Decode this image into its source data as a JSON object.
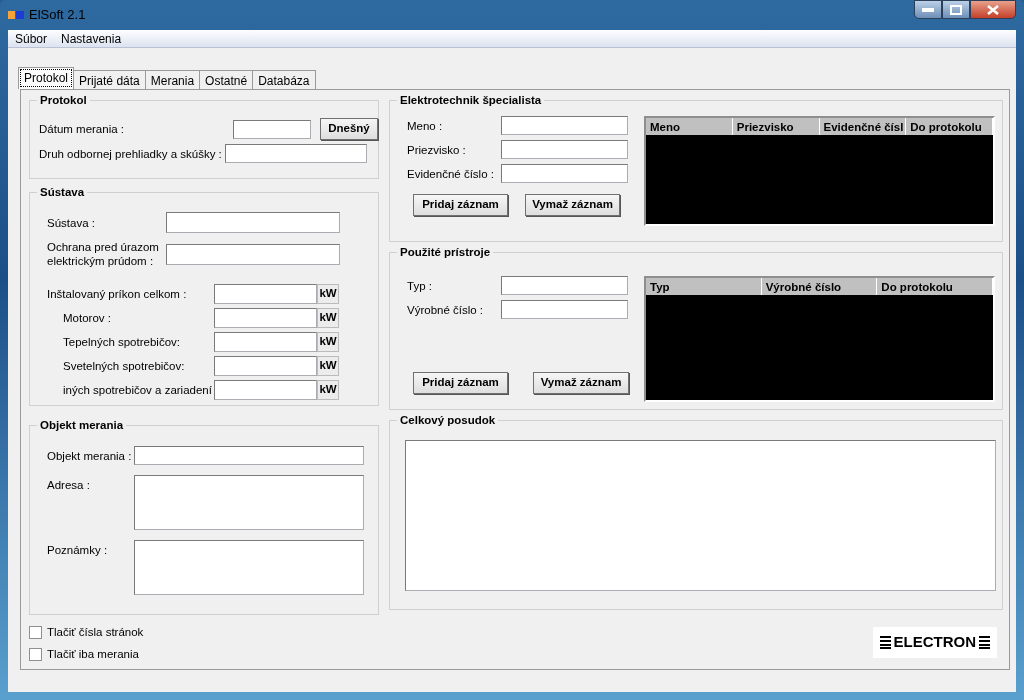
{
  "window": {
    "title": "ElSoft 2.1"
  },
  "menu": [
    {
      "label": "Súbor"
    },
    {
      "label": "Nastavenia"
    }
  ],
  "tabs": [
    {
      "label": "Protokol",
      "selected": true
    },
    {
      "label": "Prijaté dáta",
      "selected": false
    },
    {
      "label": "Merania",
      "selected": false
    },
    {
      "label": "Ostatné",
      "selected": false
    },
    {
      "label": "Databáza",
      "selected": false
    }
  ],
  "protokol": {
    "title": "Protokol",
    "rows": [
      {
        "label": "Dátum merania :",
        "button": "Dnešný"
      },
      {
        "label": "Druh odbornej prehliadky a skúšky :"
      }
    ]
  },
  "sustava": {
    "title": "Sústava",
    "rows": [
      {
        "kind": "text",
        "label": "Sústava :"
      },
      {
        "kind": "text",
        "label": "Ochrana pred úrazom elektrickým prúdom :"
      },
      {
        "kind": "total",
        "label": "Inštalovaný príkon celkom :",
        "unit": "kW"
      },
      {
        "kind": "part",
        "label": "Motorov :",
        "unit": "kW"
      },
      {
        "kind": "part",
        "label": "Tepelných spotrebičov:",
        "unit": "kW"
      },
      {
        "kind": "part",
        "label": "Svetelných spotrebičov:",
        "unit": "kW"
      },
      {
        "kind": "part",
        "label": "iných spotrebičov a zariadení",
        "unit": "kW"
      }
    ]
  },
  "objekt": {
    "title": "Objekt merania",
    "rows": [
      {
        "kind": "line",
        "label": "Objekt merania :"
      },
      {
        "kind": "area",
        "label": "Adresa :"
      },
      {
        "kind": "area",
        "label": "Poznámky :"
      }
    ]
  },
  "checkboxes": [
    {
      "label": "Tlačiť čísla stránok",
      "checked": false
    },
    {
      "label": "Tlačiť iba merania",
      "checked": false
    }
  ],
  "panels": [
    {
      "title": "Elektrotechnik špecialista",
      "fields": [
        "Meno :",
        "Priezvisko :",
        "Evidenčné číslo :"
      ],
      "buttons": [
        "Pridaj záznam",
        "Vymaž záznam"
      ],
      "table": {
        "columns": [
          "Meno",
          "Priezvisko",
          "Evidenčné čísl",
          "Do protokolu"
        ]
      }
    },
    {
      "title": "Použité prístroje",
      "fields": [
        "Typ :",
        "Výrobné číslo :"
      ],
      "buttons": [
        "Pridaj záznam",
        "Vymaž záznam"
      ],
      "table": {
        "columns": [
          "Typ",
          "Výrobné číslo",
          "Do protokolu"
        ]
      }
    }
  ],
  "posudok": {
    "title": "Celkový posudok"
  },
  "logo": {
    "text": "ELECTRON"
  }
}
